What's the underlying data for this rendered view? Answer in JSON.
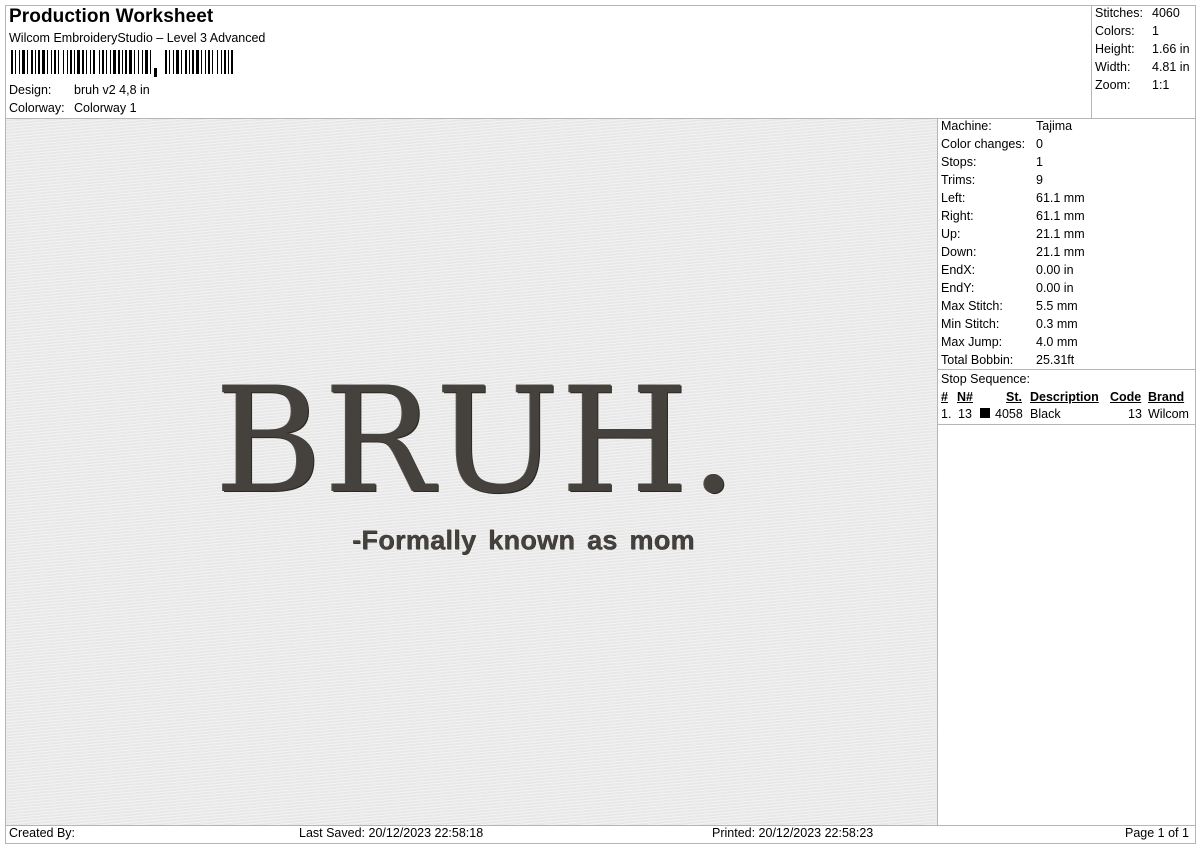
{
  "header": {
    "title": "Production Worksheet",
    "subtitle": "Wilcom EmbroideryStudio – Level 3 Advanced",
    "design_label": "Design:",
    "design_value": "bruh v2 4,8 in",
    "colorway_label": "Colorway:",
    "colorway_value": "Colorway 1"
  },
  "summary": [
    {
      "label": "Stitches:",
      "value": "4060"
    },
    {
      "label": "Colors:",
      "value": "1"
    },
    {
      "label": "Height:",
      "value": "1.66 in"
    },
    {
      "label": "Width:",
      "value": "4.81 in"
    },
    {
      "label": "Zoom:",
      "value": "1:1"
    }
  ],
  "preview": {
    "main_text": "BRUH.",
    "sub_text": "-Formally known as mom",
    "thread_color": "#45413c"
  },
  "machine_info": [
    {
      "label": "Machine:",
      "value": "Tajima"
    },
    {
      "label": "Color changes:",
      "value": "0"
    },
    {
      "label": "Stops:",
      "value": "1"
    },
    {
      "label": "Trims:",
      "value": "9"
    },
    {
      "label": "Left:",
      "value": "61.1 mm"
    },
    {
      "label": "Right:",
      "value": "61.1 mm"
    },
    {
      "label": "Up:",
      "value": "21.1 mm"
    },
    {
      "label": "Down:",
      "value": "21.1 mm"
    },
    {
      "label": "EndX:",
      "value": "0.00 in"
    },
    {
      "label": "EndY:",
      "value": "0.00 in"
    },
    {
      "label": "Max Stitch:",
      "value": "5.5 mm"
    },
    {
      "label": "Min Stitch:",
      "value": "0.3 mm"
    },
    {
      "label": "Max Jump:",
      "value": "4.0 mm"
    },
    {
      "label": "Total Bobbin:",
      "value": "25.31ft"
    }
  ],
  "stop_sequence": {
    "title": "Stop Sequence:",
    "headers": {
      "num": "#",
      "n": "N#",
      "st": "St.",
      "description": "Description",
      "code": "Code",
      "brand": "Brand"
    },
    "rows": [
      {
        "num": "1.",
        "n": "13",
        "swatch_color": "#000000",
        "st": "4058",
        "description": "Black",
        "code": "13",
        "brand": "Wilcom"
      }
    ]
  },
  "footer": {
    "created_by": "Created By:",
    "last_saved": "Last Saved: 20/12/2023 22:58:18",
    "printed": "Printed: 20/12/2023 22:58:23",
    "page": "Page 1 of 1"
  }
}
